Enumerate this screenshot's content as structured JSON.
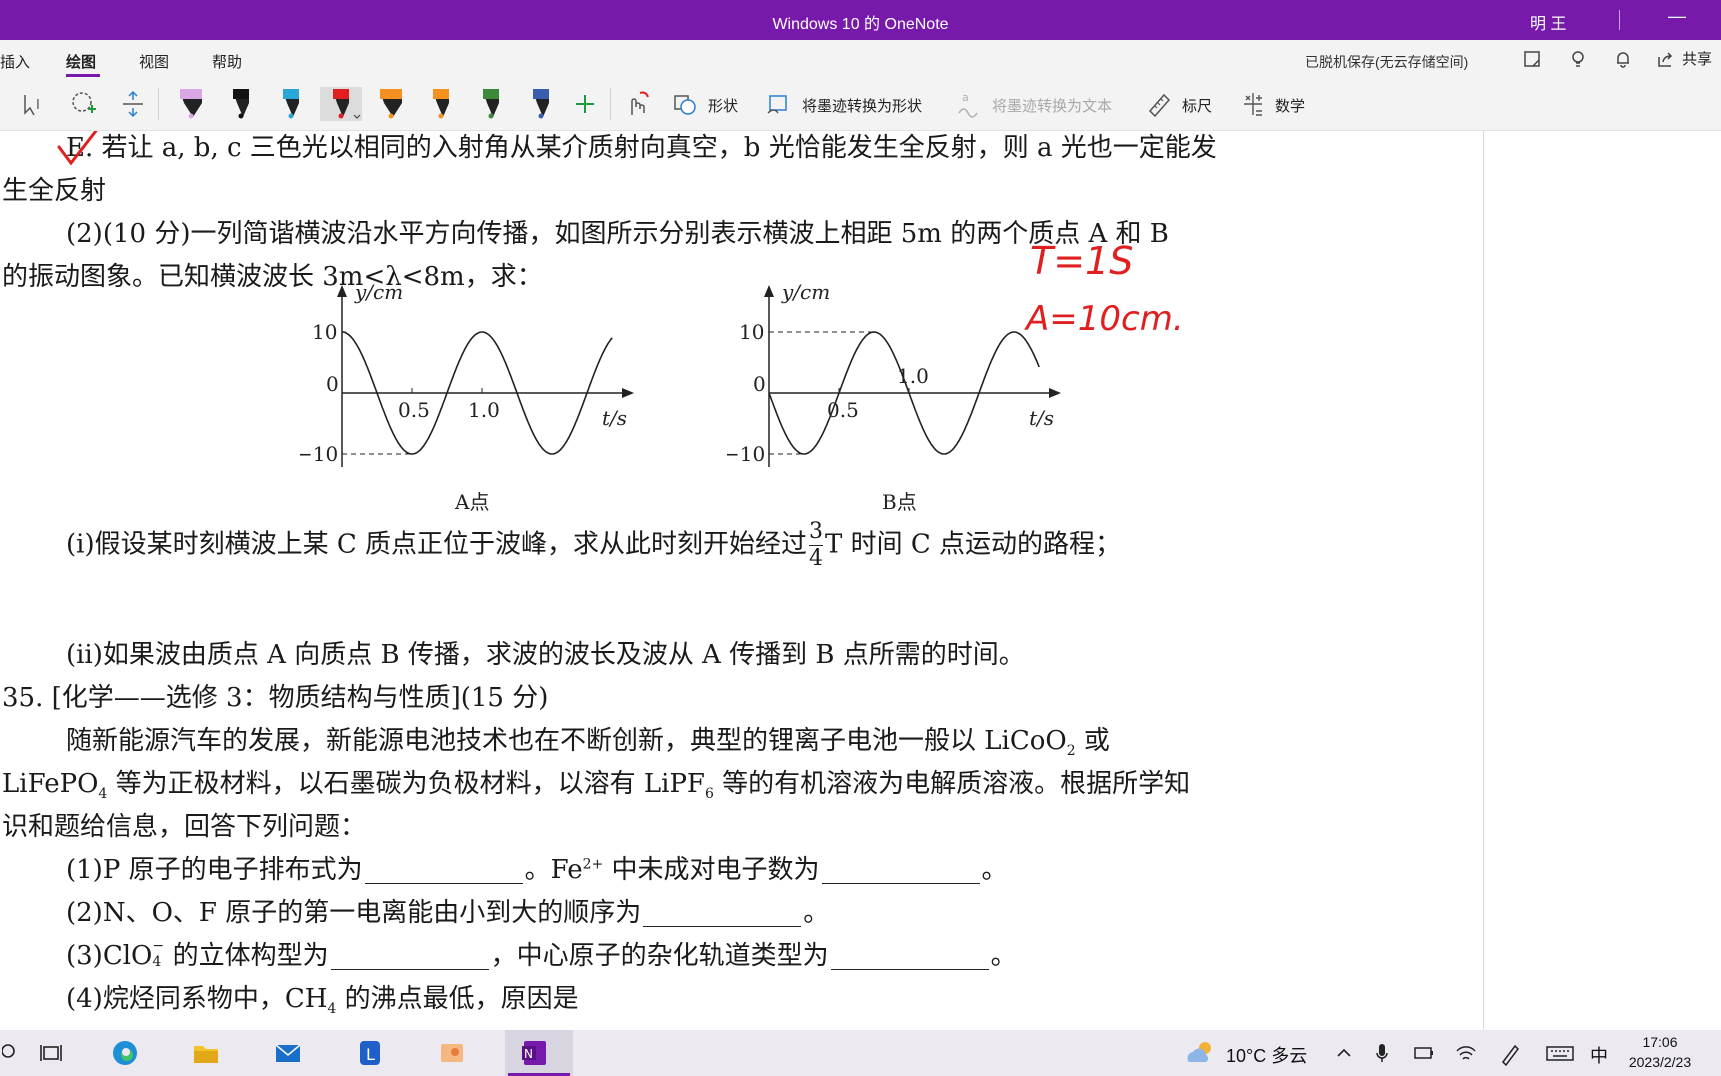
{
  "window": {
    "title": "Windows 10 的 OneNote",
    "user": "明 王",
    "minimize": "—"
  },
  "menu": {
    "items": [
      {
        "label": "插入"
      },
      {
        "label": "绘图"
      },
      {
        "label": "视图"
      },
      {
        "label": "帮助"
      }
    ],
    "active": "绘图",
    "status": "已脱机保存(无云存储空间)",
    "share": "共享"
  },
  "toolbar": {
    "shapes": "形状",
    "ink_to_shape": "将墨迹转换为形状",
    "ink_to_text": "将墨迹转换为文本",
    "ruler": "标尺",
    "math": "数学"
  },
  "pens": [
    {
      "color": "#d9a6e6",
      "kind": "highlighter"
    },
    {
      "color": "#111111",
      "kind": "pen"
    },
    {
      "color": "#2aa6d8",
      "kind": "pen"
    },
    {
      "color": "#e02020",
      "kind": "pen",
      "selected": true
    },
    {
      "color": "#f39020",
      "kind": "highlighter"
    },
    {
      "color": "#f39020",
      "kind": "pen"
    },
    {
      "color": "#3a8a3a",
      "kind": "pen"
    },
    {
      "color": "#3a5db0",
      "kind": "pen"
    }
  ],
  "document": {
    "line1": "E. 若让 a, b, c 三色光以相同的入射角从某介质射向真空，b 光恰能发生全反射，则 a 光也一定能发",
    "line2": "生全反射",
    "line3": "(2)(10 分)一列简谐横波沿水平方向传播，如图所示分别表示横波上相距 5m 的两个质点 A 和 B",
    "line4": "的振动图象。已知横波波长 3m<λ<8m，求：",
    "q_i_pre": "(ⅰ)假设某时刻横波上某 C 质点正位于波峰，求从此时刻开始经过",
    "q_i_num": "3",
    "q_i_den": "4",
    "q_i_post": "T 时间 C 点运动的路程；",
    "q_ii": "(ⅱ)如果波由质点 A 向质点 B 传播，求波的波长及波从 A 传播到 B 点所需的时间。",
    "q35": "35. [化学——选修 3：物质结构与性质](15 分)",
    "chem1_a": "随新能源汽车的发展，新能源电池技术也在不断创新，典型的锂离子电池一般以 LiCoO",
    "chem1_sub": "2",
    "chem1_b": " 或",
    "chem2_a": "LiFePO",
    "chem2_sub": "4",
    "chem2_b": " 等为正极材料，以石墨碳为负极材料，以溶有 LiPF",
    "chem2_sub2": "6",
    "chem2_c": " 等的有机溶液为电解质溶液。根据所学知",
    "chem3": "识和题给信息，回答下列问题：",
    "c1_a": "(1)P 原子的电子排布式为",
    "c1_b": "。Fe",
    "c1_sup": "2+",
    "c1_c": " 中未成对电子数为",
    "c1_d": "。",
    "c2_a": "(2)N、O、F 原子的第一电离能由小到大的顺序为",
    "c2_b": "。",
    "c3_a": "(3)ClO",
    "c3_sub": "4",
    "c3_sup": "−",
    "c3_b": " 的立体构型为",
    "c3_c": "，中心原子的杂化轨道类型为",
    "c3_d": "。",
    "c4": "(4)烷烃同系物中，CH",
    "c4_sub": "4",
    "c4_b": " 的沸点最低，原因是"
  },
  "handwriting": {
    "period": "T=1S",
    "amplitude": "A=10cm."
  },
  "chart_data": [
    {
      "type": "line",
      "title": "A点",
      "xlabel": "t/s",
      "ylabel": "y/cm",
      "x_ticks": [
        "0.5",
        "1.0"
      ],
      "y_ticks": [
        "10",
        "0",
        "−10"
      ],
      "period_s": 1.0,
      "amplitude_cm": 10,
      "function": "y = 10·cos(2πt)",
      "x": [
        0,
        0.25,
        0.5,
        0.75,
        1.0,
        1.25,
        1.5,
        1.75,
        2.0
      ],
      "y": [
        10,
        0,
        -10,
        0,
        10,
        0,
        -10,
        0,
        10
      ]
    },
    {
      "type": "line",
      "title": "B点",
      "xlabel": "t/s",
      "ylabel": "y/cm",
      "x_ticks": [
        "0.5",
        "1.0"
      ],
      "y_ticks": [
        "10",
        "0",
        "−10"
      ],
      "period_s": 1.0,
      "amplitude_cm": 10,
      "function": "y = −10·sin(2πt)",
      "x": [
        0,
        0.25,
        0.5,
        0.75,
        1.0,
        1.25,
        1.5,
        1.75,
        2.0
      ],
      "y": [
        0,
        -10,
        0,
        10,
        0,
        -10,
        0,
        10,
        0
      ]
    }
  ],
  "taskbar": {
    "weather": "10°C 多云",
    "ime": "中",
    "time": "17:06",
    "date": "2023/2/23"
  }
}
